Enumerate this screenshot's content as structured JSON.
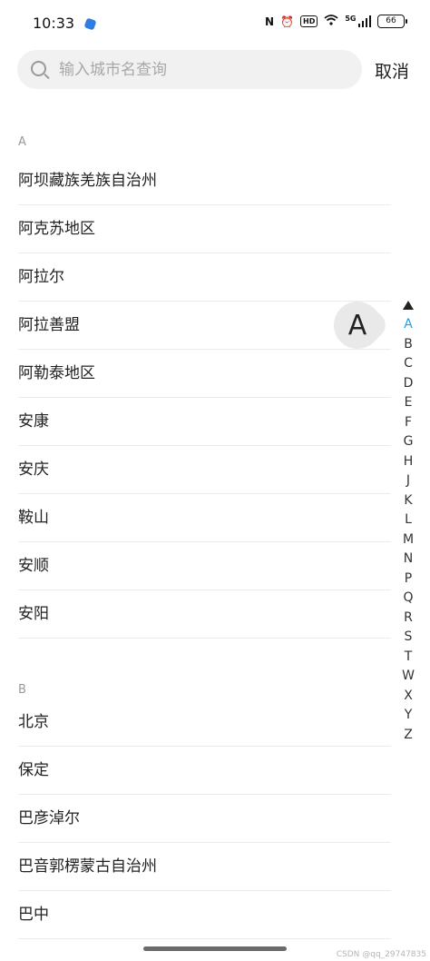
{
  "status_bar": {
    "time": "10:33",
    "battery": "66",
    "hd": "HD",
    "nfc": "N",
    "network": "5G"
  },
  "search": {
    "placeholder": "输入城市名查询",
    "value": "",
    "cancel_label": "取消"
  },
  "sections": [
    {
      "header": "A",
      "cities": [
        "阿坝藏族羌族自治州",
        "阿克苏地区",
        "阿拉尔",
        "阿拉善盟",
        "阿勒泰地区",
        "安康",
        "安庆",
        "鞍山",
        "安顺",
        "安阳"
      ]
    },
    {
      "header": "B",
      "cities": [
        "北京",
        "保定",
        "巴彦淖尔",
        "巴音郭楞蒙古自治州",
        "巴中"
      ]
    }
  ],
  "index": {
    "letters": [
      "A",
      "B",
      "C",
      "D",
      "E",
      "F",
      "G",
      "H",
      "J",
      "K",
      "L",
      "M",
      "N",
      "P",
      "Q",
      "R",
      "S",
      "T",
      "W",
      "X",
      "Y",
      "Z"
    ],
    "active": "A",
    "bubble_letter": "A"
  },
  "colors": {
    "accent": "#1e9ee8",
    "divider": "#ebebeb",
    "search_bg": "#f1f1f1"
  },
  "watermark": "CSDN @qq_29747835"
}
